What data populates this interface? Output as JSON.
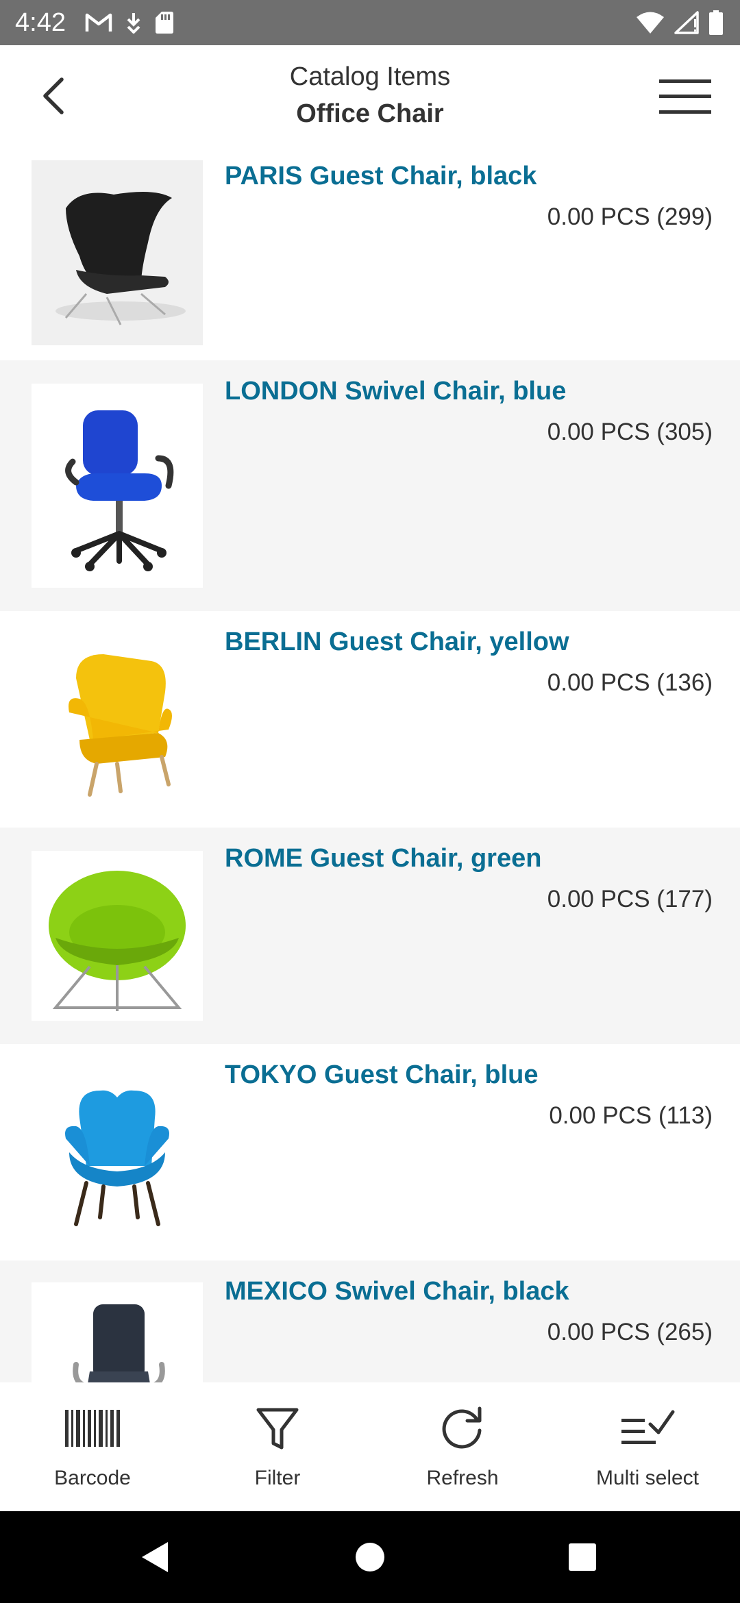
{
  "status_bar": {
    "time": "4:42",
    "left_icons": [
      "gmail-icon",
      "download-icon",
      "sd-card-icon"
    ],
    "right_icons": [
      "wifi-icon",
      "signal-icon",
      "battery-icon"
    ]
  },
  "header": {
    "title": "Catalog Items",
    "subtitle": "Office Chair"
  },
  "items": [
    {
      "name": "PARIS Guest Chair, black",
      "qty": "0.00 PCS (299)",
      "image": "black-lounge-chair"
    },
    {
      "name": "LONDON Swivel Chair, blue",
      "qty": "0.00 PCS (305)",
      "image": "blue-swivel-chair"
    },
    {
      "name": "BERLIN Guest Chair, yellow",
      "qty": "0.00 PCS (136)",
      "image": "yellow-armchair"
    },
    {
      "name": "ROME Guest Chair, green",
      "qty": "0.00 PCS (177)",
      "image": "green-pod-chair"
    },
    {
      "name": "TOKYO Guest Chair, blue",
      "qty": "0.00 PCS (113)",
      "image": "blue-wing-chair"
    },
    {
      "name": "MEXICO Swivel Chair, black",
      "qty": "0.00 PCS (265)",
      "image": "black-office-chair"
    }
  ],
  "toolbar": {
    "barcode_label": "Barcode",
    "filter_label": "Filter",
    "refresh_label": "Refresh",
    "multiselect_label": "Multi select"
  },
  "colors": {
    "accent": "#0a6e93",
    "status_bar": "#6f6f6f",
    "row_alt": "#f5f5f5"
  }
}
